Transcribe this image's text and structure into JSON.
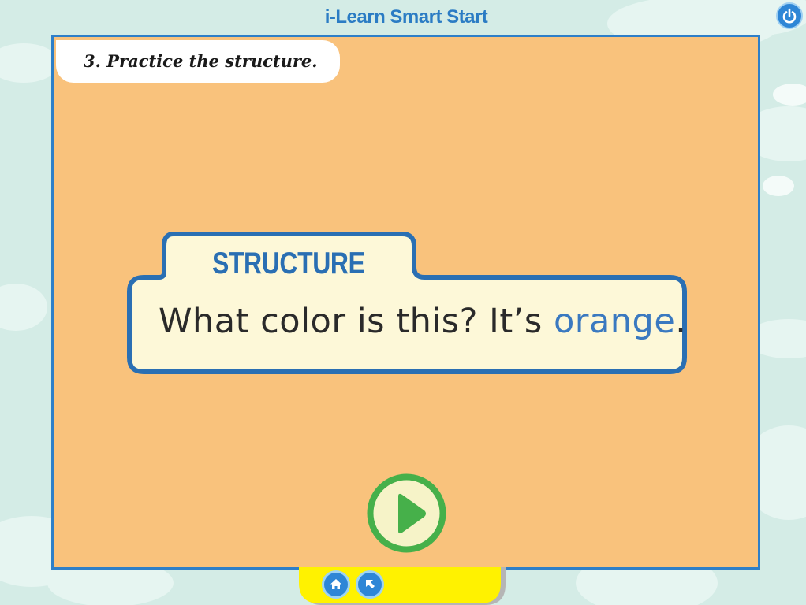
{
  "app": {
    "title": "i-Learn Smart Start"
  },
  "activity": {
    "instruction": "3. Practice the structure."
  },
  "structure_card": {
    "label": "STRUCTURE",
    "sentence_prefix": "What color is this? It’s ",
    "sentence_highlight": "orange",
    "sentence_suffix": "."
  },
  "controls": {
    "power_icon": "power-icon",
    "play_icon": "play-icon",
    "home_icon": "home-icon",
    "back_icon": "back-arrow-icon"
  },
  "colors": {
    "stage_bg": "#f9c27c",
    "stage_border": "#2e7fc8",
    "card_bg": "#fdf8d8",
    "card_border": "#2a6fb3",
    "highlight_text": "#3a79c0",
    "play_green": "#46b04a",
    "bottom_bar": "#fff200"
  }
}
